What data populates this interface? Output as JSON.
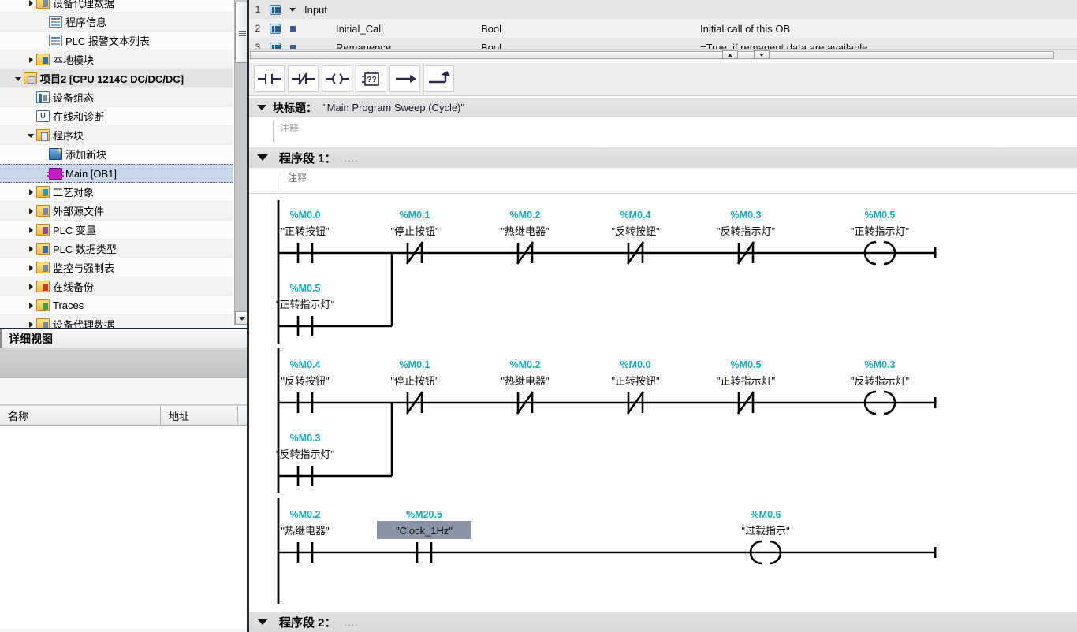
{
  "sidebar": {
    "tree": [
      {
        "label": "设备代理数据",
        "indent": 2,
        "arrow": "right",
        "icon": "folder-gray-icon",
        "selected": false,
        "bold": false
      },
      {
        "label": "程序信息",
        "indent": 3,
        "arrow": "none",
        "icon": "program-info-icon",
        "selected": false,
        "bold": false
      },
      {
        "label": "PLC 报警文本列表",
        "indent": 3,
        "arrow": "none",
        "icon": "alarm-text-list-icon",
        "selected": false,
        "bold": false
      },
      {
        "label": "本地模块",
        "indent": 2,
        "arrow": "right",
        "icon": "folder-blue-icon",
        "selected": false,
        "bold": false
      },
      {
        "label": "项目2 [CPU 1214C DC/DC/DC]",
        "indent": 1,
        "arrow": "down",
        "icon": "plc-device-icon",
        "selected": false,
        "bold": true
      },
      {
        "label": "设备组态",
        "indent": 2,
        "arrow": "none",
        "icon": "device-config-icon",
        "selected": false,
        "bold": false
      },
      {
        "label": "在线和诊断",
        "indent": 2,
        "arrow": "none",
        "icon": "online-diagnostics-icon",
        "selected": false,
        "bold": false
      },
      {
        "label": "程序块",
        "indent": 2,
        "arrow": "down",
        "icon": "folder-program-blocks-icon",
        "selected": false,
        "bold": false
      },
      {
        "label": "添加新块",
        "indent": 3,
        "arrow": "none",
        "icon": "add-new-block-icon",
        "selected": false,
        "bold": false
      },
      {
        "label": "Main [OB1]",
        "indent": 3,
        "arrow": "none",
        "icon": "ob-block-icon",
        "selected": true,
        "bold": false
      },
      {
        "label": "工艺对象",
        "indent": 2,
        "arrow": "right",
        "icon": "folder-tech-objects-icon",
        "selected": false,
        "bold": false
      },
      {
        "label": "外部源文件",
        "indent": 2,
        "arrow": "right",
        "icon": "folder-external-source-icon",
        "selected": false,
        "bold": false
      },
      {
        "label": "PLC 变量",
        "indent": 2,
        "arrow": "right",
        "icon": "folder-plc-tags-icon",
        "selected": false,
        "bold": false
      },
      {
        "label": "PLC 数据类型",
        "indent": 2,
        "arrow": "right",
        "icon": "folder-plc-datatypes-icon",
        "selected": false,
        "bold": false
      },
      {
        "label": "监控与强制表",
        "indent": 2,
        "arrow": "right",
        "icon": "folder-watch-force-icon",
        "selected": false,
        "bold": false
      },
      {
        "label": "在线备份",
        "indent": 2,
        "arrow": "right",
        "icon": "folder-online-backup-icon",
        "selected": false,
        "bold": false
      },
      {
        "label": "Traces",
        "indent": 2,
        "arrow": "right",
        "icon": "folder-traces-icon",
        "selected": false,
        "bold": false
      },
      {
        "label": "设备代理数据",
        "indent": 2,
        "arrow": "right",
        "icon": "folder-device-proxy-icon",
        "selected": false,
        "bold": false
      }
    ]
  },
  "detail_view": {
    "title": "详细视图",
    "columns": [
      "名称",
      "地址"
    ]
  },
  "interface": {
    "rows": [
      {
        "num": "1",
        "name": "Input",
        "type": "",
        "comment": ""
      },
      {
        "num": "2",
        "name": "Initial_Call",
        "type": "Bool",
        "comment": "Initial call of this OB"
      },
      {
        "num": "3",
        "name": "Remanence",
        "type": "Bool",
        "comment": "=True, if remanent data are available"
      }
    ]
  },
  "toolbar": {
    "buttons": [
      {
        "name": "no-contact-button",
        "tooltip": "常开触点"
      },
      {
        "name": "nc-contact-button",
        "tooltip": "常闭触点"
      },
      {
        "name": "coil-button",
        "tooltip": "输出线圈"
      },
      {
        "name": "empty-box-button",
        "tooltip": "空功能框"
      },
      {
        "name": "open-branch-button",
        "tooltip": "打开分支"
      },
      {
        "name": "close-branch-button",
        "tooltip": "关闭分支"
      }
    ]
  },
  "block": {
    "title_label": "块标题：",
    "title_value": "\"Main Program Sweep (Cycle)\"",
    "comment_placeholder": "注释"
  },
  "networks": [
    {
      "label": "程序段 1：",
      "dots": "....",
      "comment_placeholder": "注释"
    },
    {
      "label": "程序段 2：",
      "dots": "....",
      "comment_placeholder": ""
    }
  ],
  "colors": {
    "address": "#1aa6b7",
    "selection_blue": "#c9d7e8",
    "element_selected": "#8b95a6",
    "rail": "#000000"
  },
  "ladder": {
    "rungs": [
      {
        "id": "rung-1",
        "elements": [
          {
            "type": "contact-no",
            "addr": "%M0.0",
            "name": "\"正转按钮\"",
            "selected": false
          },
          {
            "type": "contact-nc",
            "addr": "%M0.1",
            "name": "\"停止按钮\"",
            "selected": false
          },
          {
            "type": "contact-nc",
            "addr": "%M0.2",
            "name": "\"热继电器\"",
            "selected": false
          },
          {
            "type": "contact-nc",
            "addr": "%M0.4",
            "name": "\"反转按钮\"",
            "selected": false
          },
          {
            "type": "contact-nc",
            "addr": "%M0.3",
            "name": "\"反转指示灯\"",
            "selected": false
          },
          {
            "type": "coil",
            "addr": "%M0.5",
            "name": "\"正转指示灯\"",
            "selected": false
          }
        ],
        "branch": [
          {
            "type": "contact-no",
            "addr": "%M0.5",
            "name": "\"正转指示灯\"",
            "selected": false
          }
        ]
      },
      {
        "id": "rung-2",
        "elements": [
          {
            "type": "contact-no",
            "addr": "%M0.4",
            "name": "\"反转按钮\"",
            "selected": false
          },
          {
            "type": "contact-nc",
            "addr": "%M0.1",
            "name": "\"停止按钮\"",
            "selected": false
          },
          {
            "type": "contact-nc",
            "addr": "%M0.2",
            "name": "\"热继电器\"",
            "selected": false
          },
          {
            "type": "contact-nc",
            "addr": "%M0.0",
            "name": "\"正转按钮\"",
            "selected": false
          },
          {
            "type": "contact-nc",
            "addr": "%M0.5",
            "name": "\"正转指示灯\"",
            "selected": false
          },
          {
            "type": "coil",
            "addr": "%M0.3",
            "name": "\"反转指示灯\"",
            "selected": false
          }
        ],
        "branch": [
          {
            "type": "contact-no",
            "addr": "%M0.3",
            "name": "\"反转指示灯\"",
            "selected": false
          }
        ]
      },
      {
        "id": "rung-3",
        "elements": [
          {
            "type": "contact-no",
            "addr": "%M0.2",
            "name": "\"热继电器\"",
            "selected": false
          },
          {
            "type": "contact-no",
            "addr": "%M20.5",
            "name": "\"Clock_1Hz\"",
            "selected": true
          },
          {
            "type": "coil",
            "addr": "%M0.6",
            "name": "\"过载指示\"",
            "selected": false
          }
        ],
        "branch": []
      }
    ]
  }
}
